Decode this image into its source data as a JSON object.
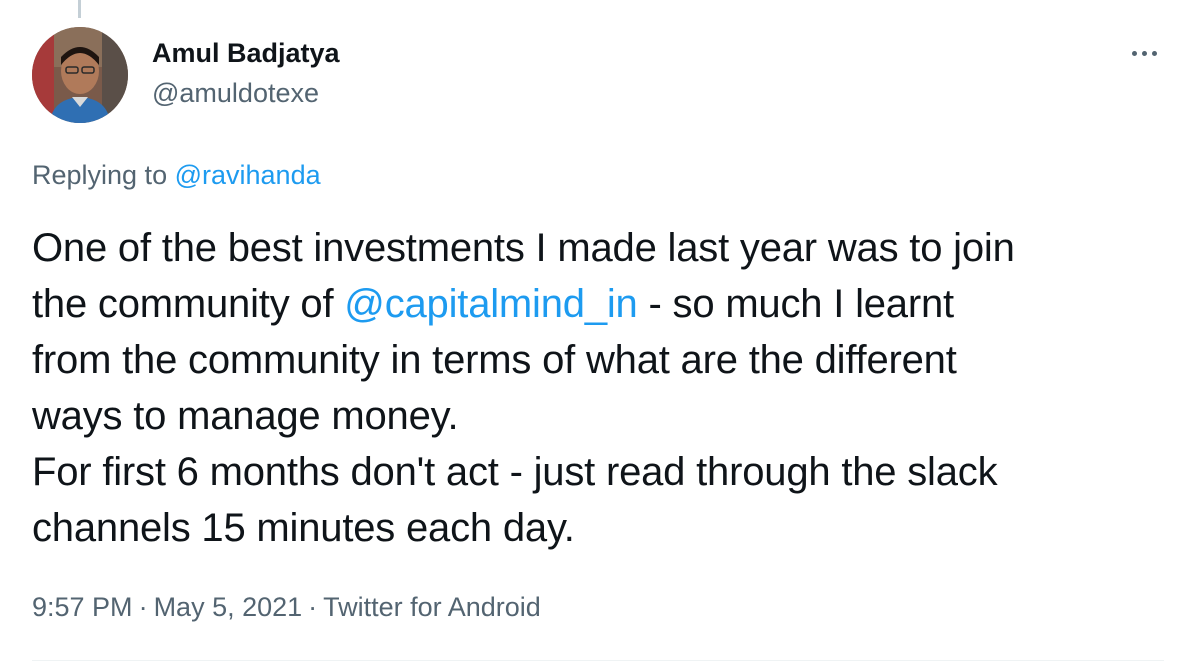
{
  "author": {
    "name": "Amul Badjatya",
    "handle": "@amuldotexe",
    "avatar_icon": "user-avatar-photo"
  },
  "more_icon": "ellipsis-horizontal-icon",
  "reply": {
    "prefix": "Replying to",
    "mention": "@ravihanda"
  },
  "tweet": {
    "line1": "One of the best investments I made last year was to join",
    "line2_before": "the community of ",
    "line2_mention": "@capitalmind_in",
    "line2_after": " - so much I learnt",
    "line3": "from the community in terms of what are the different",
    "line4": "ways to manage money.",
    "line5": "For first 6 months don't act - just read through the slack",
    "line6": "channels 15 minutes each day."
  },
  "meta": {
    "time": "9:57 PM",
    "separator": "·",
    "date": "May 5, 2021",
    "source": "Twitter for Android"
  },
  "colors": {
    "link": "#1d9bf0",
    "secondary_text": "#536471",
    "primary_text": "#0f1419"
  }
}
